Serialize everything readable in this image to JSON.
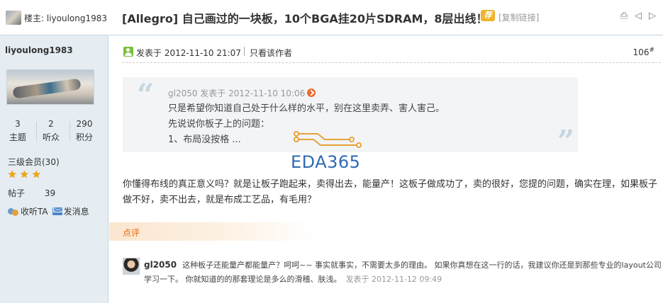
{
  "sidebar": {
    "header_author": "楼主: liyoulong1983",
    "username": "liyoulong1983",
    "stats": [
      {
        "value": "3",
        "label": "主题"
      },
      {
        "value": "2",
        "label": "听众"
      },
      {
        "value": "290",
        "label": "积分"
      }
    ],
    "rank": "三级会员(30)",
    "star_count": 3,
    "posts_label": "帖子",
    "posts_value": "39",
    "listen_label": "收听TA",
    "message_label": "发消息"
  },
  "thread": {
    "title": "[Allegro] 自己画过的一块板，10个BGA挂20片SDRAM，8层出线！",
    "badge": "荐",
    "copy_link": "[复制链接]",
    "icons": [
      "print-icon",
      "prev-thread-icon",
      "next-thread-icon"
    ]
  },
  "post": {
    "date": "发表于 2012-11-10 21:07",
    "only_author": "只看该作者",
    "floor": "106",
    "floor_mark": "#",
    "quote": {
      "open_mark": "“",
      "close_mark": "”",
      "header": "gl2050 发表于 2012-11-10 10:06",
      "lines": [
        "只是希望你知道自己处于什么样的水平，别在这里卖弄、害人害己。",
        "先说说你板子上的问题：",
        "1、布局没按格 ..."
      ]
    },
    "watermark": "EDA365",
    "body": "你懂得布线的真正意义吗？就是让板子跑起来，卖得出去，能量产！这板子做成功了，卖的很好，您提的问题，确实在理，如果板子做不好，卖不出去，就是布成工艺品，有毛用？"
  },
  "comments": {
    "label": "点评",
    "items": [
      {
        "user": "gl2050",
        "text": "这种板子还能量产都能量产？呵呵~~ 事实就事实，不需要太多的理由。 如果你真想在这一行的话，我建议你还是到那些专业的layout公司学习一下。 你就知道的的那套理论是多么的滑稽、肤浅。",
        "time": "发表于 2012-11-12 09:49"
      }
    ]
  },
  "colors": {
    "sidebar_bg": "#e5edf2",
    "border": "#c2d5e3",
    "quote_bg": "#f2f4f6",
    "comment_accent": "#e26b10",
    "watermark": "#2f6ab4"
  }
}
